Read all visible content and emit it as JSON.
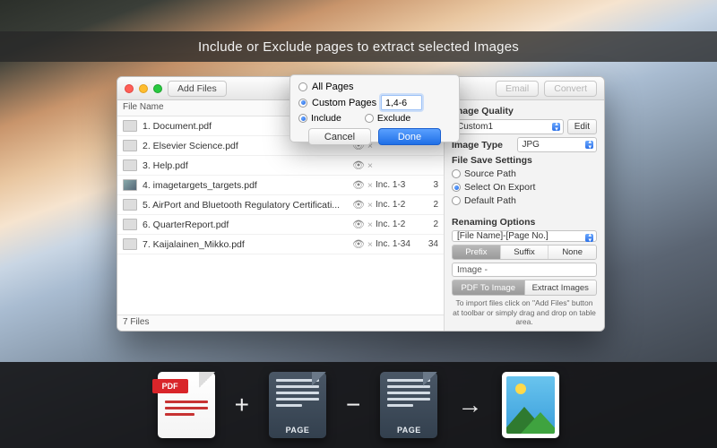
{
  "banner": "Include or Exclude pages to extract selected Images",
  "toolbar": {
    "add_files": "Add Files",
    "email": "Email",
    "convert": "Convert"
  },
  "list": {
    "header": "File Name",
    "footer": "7 Files",
    "rows": [
      {
        "name": "1. Document.pdf",
        "inc": "",
        "count": "",
        "photo": false
      },
      {
        "name": "2. Elsevier Science.pdf",
        "inc": "",
        "count": "",
        "photo": false
      },
      {
        "name": "3. Help.pdf",
        "inc": "",
        "count": "",
        "photo": false
      },
      {
        "name": "4. imagetargets_targets.pdf",
        "inc": "Inc. 1-3",
        "count": "3",
        "photo": true
      },
      {
        "name": "5. AirPort and Bluetooth Regulatory Certificati...",
        "inc": "Inc. 1-2",
        "count": "2",
        "photo": false
      },
      {
        "name": "6. QuarterReport.pdf",
        "inc": "Inc. 1-2",
        "count": "2",
        "photo": false
      },
      {
        "name": "7. Kaijalainen_Mikko.pdf",
        "inc": "Inc. 1-34",
        "count": "34",
        "photo": false
      }
    ]
  },
  "popover": {
    "all_pages": "All Pages",
    "custom_pages": "Custom Pages",
    "value": "1,4-6",
    "include": "Include",
    "exclude": "Exclude",
    "cancel": "Cancel",
    "done": "Done"
  },
  "right": {
    "image_quality_label": "Image Quality",
    "image_quality_value": "Custom1",
    "edit": "Edit",
    "image_type_label": "Image Type",
    "image_type_value": "JPG",
    "file_save_settings": "File Save Settings",
    "source_path": "Source Path",
    "select_on_export": "Select On Export",
    "default_path": "Default Path",
    "renaming_options": "Renaming Options",
    "renaming_value": "[File Name]-[Page No.]",
    "seg_prefix": "Prefix",
    "seg_suffix": "Suffix",
    "seg_none": "None",
    "custom_text": "Image -",
    "action_left": "PDF To Image",
    "action_right": "Extract Images",
    "hint": "To import files click on \"Add Files\" button at toolbar or simply drag and drop on table area."
  },
  "strip": {
    "pdf_label": "PDF",
    "page_label": "PAGE"
  }
}
